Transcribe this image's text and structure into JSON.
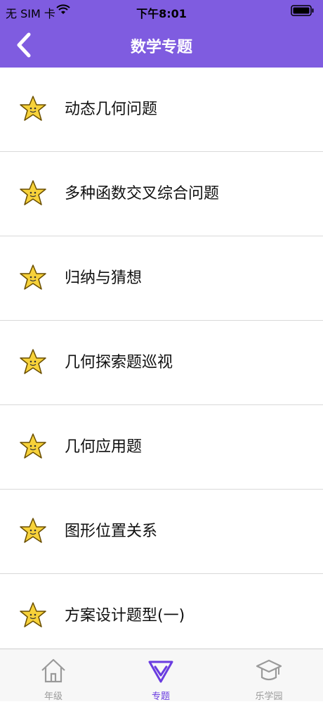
{
  "status_bar": {
    "carrier": "无 SIM 卡",
    "time": "下午8:01"
  },
  "nav": {
    "title": "数学专题",
    "back_icon": "chevron-left-icon"
  },
  "topics": [
    "动态几何问题",
    "多种函数交叉综合问题",
    "归纳与猜想",
    "几何探索题巡视",
    "几何应用题",
    "图形位置关系",
    "方案设计题型(一)"
  ],
  "tabbar": {
    "tabs": [
      {
        "label": "年级",
        "icon": "house-icon",
        "active": false
      },
      {
        "label": "专题",
        "icon": "topic-v-icon",
        "active": true
      },
      {
        "label": "乐学园",
        "icon": "graduation-cap-icon",
        "active": false
      }
    ]
  },
  "colors": {
    "header": "#7f5ce0",
    "active_tab": "#6a3ce0",
    "inactive_tab": "#9a9a9a",
    "star": "#f7d23a"
  }
}
